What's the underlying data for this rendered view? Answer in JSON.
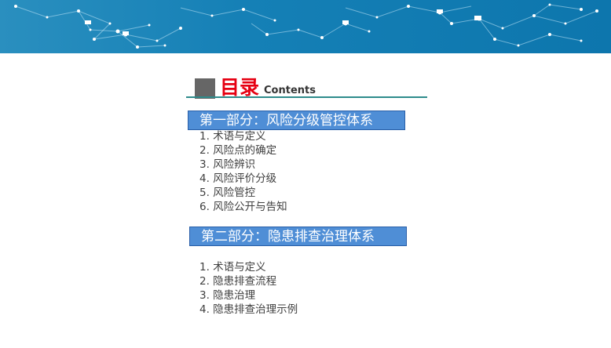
{
  "header": {
    "title_cn": "目录",
    "title_en": "Contents"
  },
  "sections": [
    {
      "heading": "第一部分：风险分级管控体系",
      "items": [
        "1. 术语与定义",
        "2. 风险点的确定",
        "3. 风险辨识",
        "4. 风险评价分级",
        "5. 风险管控",
        "6. 风险公开与告知"
      ]
    },
    {
      "heading": "第二部分：隐患排查治理体系",
      "items": [
        "1. 术语与定义",
        "2. 隐患排查流程",
        "3. 隐患治理",
        "4. 隐患排查治理示例"
      ]
    }
  ],
  "colors": {
    "banner": "#1580b6",
    "title_red": "#e60012",
    "section_bar": "#4f8ed6",
    "underline": "#2e8b8b"
  }
}
